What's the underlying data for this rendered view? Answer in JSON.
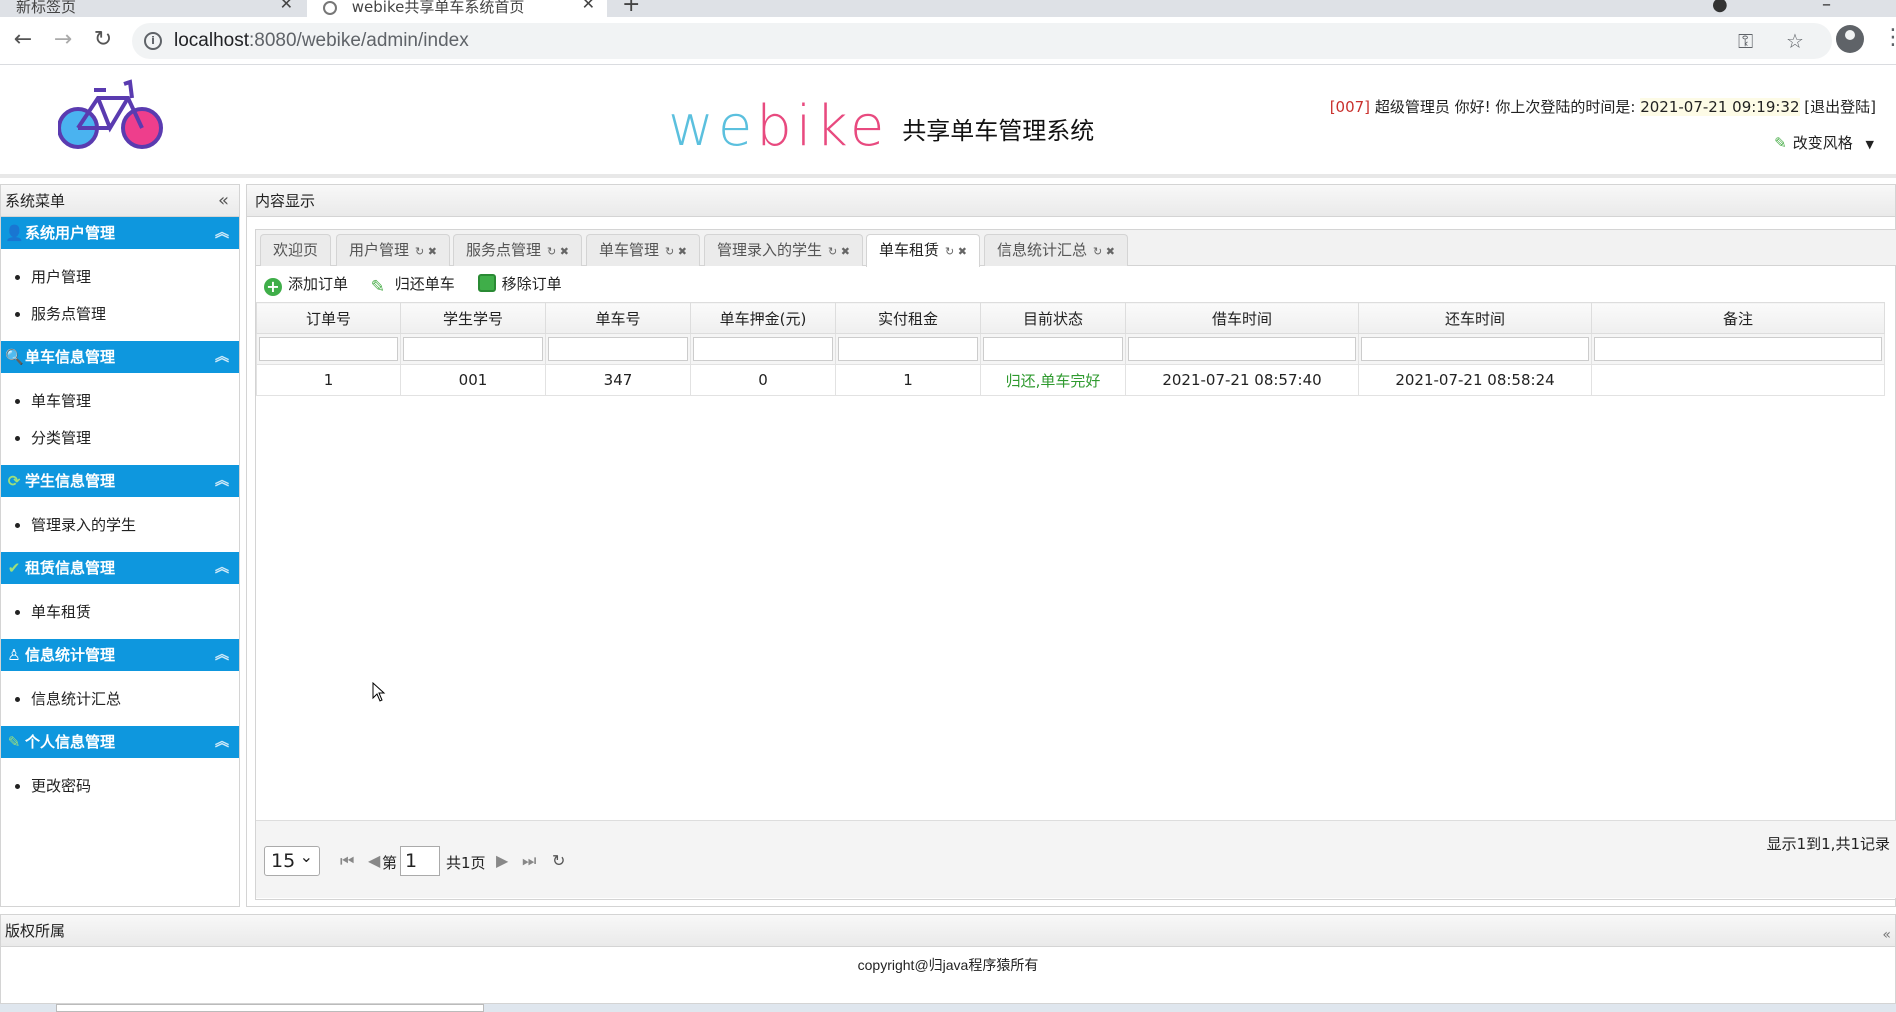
{
  "browser": {
    "tabs": [
      {
        "title": "新标签页"
      },
      {
        "title": "webike共享单车系统首页"
      }
    ],
    "new_tab": "+",
    "url_host": "localhost",
    "url_path": ":8080/webike/admin/index"
  },
  "header": {
    "brand_chars": [
      "w",
      "e",
      "b",
      "i",
      "k",
      "e"
    ],
    "system_name": "共享单车管理系统",
    "user_code": "[007]",
    "greeting": " 超级管理员 你好! 你上次登陆的时间是: ",
    "last_login": "2021-07-21 09:19:32",
    "logout": " [退出登陆]",
    "change_style": "改变风格"
  },
  "sidebar": {
    "title": "系统菜单",
    "groups": [
      {
        "title": "系统用户管理",
        "icon": "user-icon",
        "items": [
          "用户管理",
          "服务点管理"
        ]
      },
      {
        "title": "单车信息管理",
        "icon": "search-icon",
        "items": [
          "单车管理",
          "分类管理"
        ]
      },
      {
        "title": "学生信息管理",
        "icon": "refresh-icon",
        "items": [
          "管理录入的学生"
        ]
      },
      {
        "title": "租赁信息管理",
        "icon": "check-icon",
        "items": [
          "单车租赁"
        ]
      },
      {
        "title": "信息统计管理",
        "icon": "lamp-icon",
        "items": [
          "信息统计汇总"
        ]
      },
      {
        "title": "个人信息管理",
        "icon": "pencil-icon",
        "items": [
          "更改密码"
        ]
      }
    ]
  },
  "main": {
    "title": "内容显示",
    "tabs": [
      "欢迎页",
      "用户管理",
      "服务点管理",
      "单车管理",
      "管理录入的学生",
      "单车租赁",
      "信息统计汇总"
    ],
    "active_tab": "单车租赁",
    "toolbar": {
      "add": "添加订单",
      "return": "归还单车",
      "remove": "移除订单"
    },
    "table": {
      "columns": [
        "订单号",
        "学生学号",
        "单车号",
        "单车押金(元)",
        "实付租金",
        "目前状态",
        "借车时间",
        "还车时间",
        "备注"
      ],
      "rows": [
        [
          "1",
          "001",
          "347",
          "0",
          "1",
          "归还,单车完好",
          "2021-07-21 08:57:40",
          "2021-07-21 08:58:24",
          ""
        ]
      ]
    },
    "pager": {
      "page_size": "15",
      "page_label": "第",
      "page": "1",
      "total_label": "共1页",
      "info": "显示1到1,共1记录"
    }
  },
  "footer": {
    "title": "版权所属",
    "copyright": "copyright@归java程序猿所有"
  },
  "colors": {
    "menu_blue": "#0e97de",
    "status_green": "#2f9a2f",
    "user_code_red": "#c9302c"
  }
}
